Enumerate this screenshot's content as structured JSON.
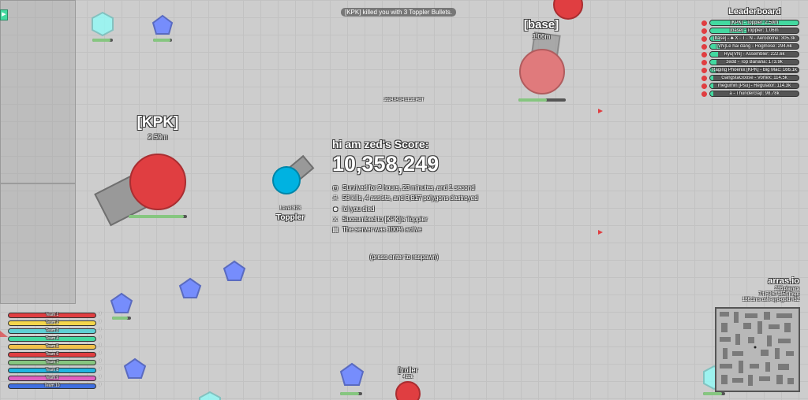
{
  "killer_message": "[KPK] killed you with 3 Toppler Bullets.",
  "timestamp": "2024.04.04 11:21 PDT",
  "players": {
    "kpk": {
      "name": "[KPK]",
      "score": "2.59m",
      "color": "#e03e41"
    },
    "base": {
      "name": "[base]",
      "score": "1.06m",
      "color": "#e03e41"
    },
    "self": {
      "level": "Level 323",
      "class": "Toppler",
      "color": "#00b2e1"
    },
    "troller": {
      "name": "[troller",
      "score": "4.82k"
    }
  },
  "death": {
    "heading": "hi am zed's Score:",
    "score": "10,358,249",
    "stats": [
      {
        "icon": "clock-icon",
        "text": "Survived for 2 hours, 23 minutes, and 1 second"
      },
      {
        "icon": "skull-crossbones-icon",
        "text": "58 kills, 4 assists, and 3,817 polygons destroyed"
      },
      {
        "icon": "skull-icon",
        "text": "lol you died"
      },
      {
        "icon": "sword-icon",
        "text": "Succumbed to [KPK]'s Toppler"
      },
      {
        "icon": "server-icon",
        "text": "The server was 100% active"
      }
    ],
    "respawn": "(press enter to respawn)"
  },
  "leaderboard": {
    "title": "Leaderboard",
    "entries": [
      {
        "text": "[KPK] - Toppler: 2.59m",
        "fill": 1.0
      },
      {
        "text": "[base] - Toppler: 1.06m",
        "fill": 0.41
      },
      {
        "text": "[base] - ♣ X · T · N - Aerodome: 305.3k",
        "fill": 0.12
      },
      {
        "text": "[VN]Le hai dang - Hogmose: 294.6k",
        "fill": 0.11
      },
      {
        "text": "Ryu[VN] - Assembler: 222.6k",
        "fill": 0.09
      },
      {
        "text": "zedd - Top Banana: 173.9k",
        "fill": 0.07
      },
      {
        "text": "Raging Phoenix [KPK] - Big Mac: 166.1k",
        "fill": 0.06
      },
      {
        "text": "GangstaGoose - Vortex: 114.5k",
        "fill": 0.04
      },
      {
        "text": "megumin [Psu] - Regulator: 114.3k",
        "fill": 0.04
      },
      {
        "text": "a - Thunderclap: 98.78k",
        "fill": 0.04
      }
    ]
  },
  "team_bars": [
    {
      "label": "Team 1",
      "color": "#e03e41",
      "count": "0"
    },
    {
      "label": "Team 2",
      "color": "#f5d54b",
      "count": "0"
    },
    {
      "label": "Team 3",
      "color": "#5ed0d5",
      "count": "0"
    },
    {
      "label": "Team 4",
      "color": "#43d9a0",
      "count": "0"
    },
    {
      "label": "Team 5",
      "color": "#f0c14b",
      "count": "0"
    },
    {
      "label": "Team 6",
      "color": "#e03e41",
      "count": "0"
    },
    {
      "label": "Team 7",
      "color": "#86c680",
      "count": "0"
    },
    {
      "label": "Team 8",
      "color": "#1fb5e0",
      "count": "0"
    },
    {
      "label": "Team 9",
      "color": "#e060c0",
      "count": "0"
    },
    {
      "label": "Team 10",
      "color": "#3f6fe0",
      "count": "0"
    }
  ],
  "server": {
    "title": "arras.io",
    "players": "286 players",
    "fps": "74 FPS / 1.54 mspt",
    "info": "166.1ms  oshi-syd-gold #32"
  },
  "colors": {
    "shape_blue": "#768dfc",
    "shape_green": "#8efffb",
    "enemy_red": "#e03e41",
    "barrel": "#999999"
  }
}
